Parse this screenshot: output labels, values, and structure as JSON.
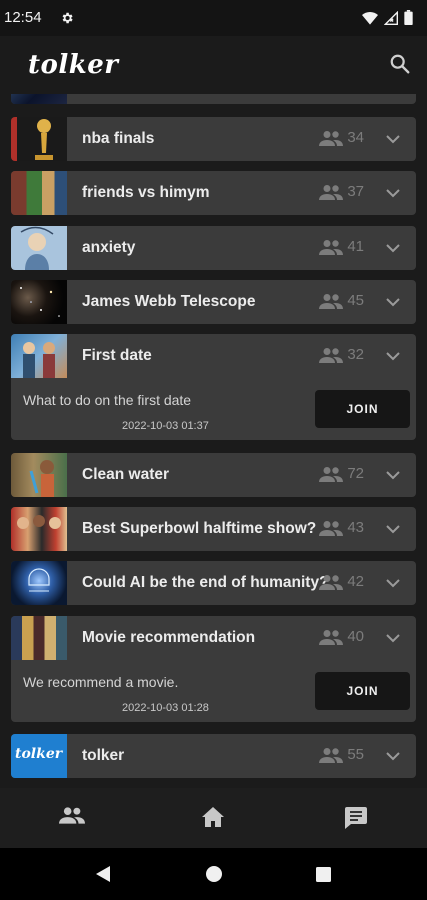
{
  "status": {
    "time": "12:54"
  },
  "app": {
    "title": "tolker"
  },
  "rooms": [
    {
      "title": "nba finals",
      "count": "34"
    },
    {
      "title": "friends vs himym",
      "count": "37"
    },
    {
      "title": "anxiety",
      "count": "41"
    },
    {
      "title": "James Webb Telescope",
      "count": "45"
    },
    {
      "title": "First date",
      "count": "32",
      "description": "What to do on the first date",
      "timestamp": "2022-10-03 01:37",
      "join_label": "JOIN"
    },
    {
      "title": "Clean water",
      "count": "72"
    },
    {
      "title": "Best Superbowl halftime show?",
      "count": "43"
    },
    {
      "title": "Could AI be the end of humanity?",
      "count": "42"
    },
    {
      "title": "Movie recommendation",
      "count": "40",
      "description": "We recommend a movie.",
      "timestamp": "2022-10-03 01:28",
      "join_label": "JOIN"
    },
    {
      "title": "tolker",
      "count": "55",
      "thumb_text": "tolker"
    }
  ],
  "bottom_nav": {
    "icons": [
      "people-icon",
      "home-icon",
      "chat-icon"
    ]
  },
  "colors": {
    "card": "#3b3b3b",
    "background": "#1b1b1b",
    "join_button": "#161616"
  }
}
